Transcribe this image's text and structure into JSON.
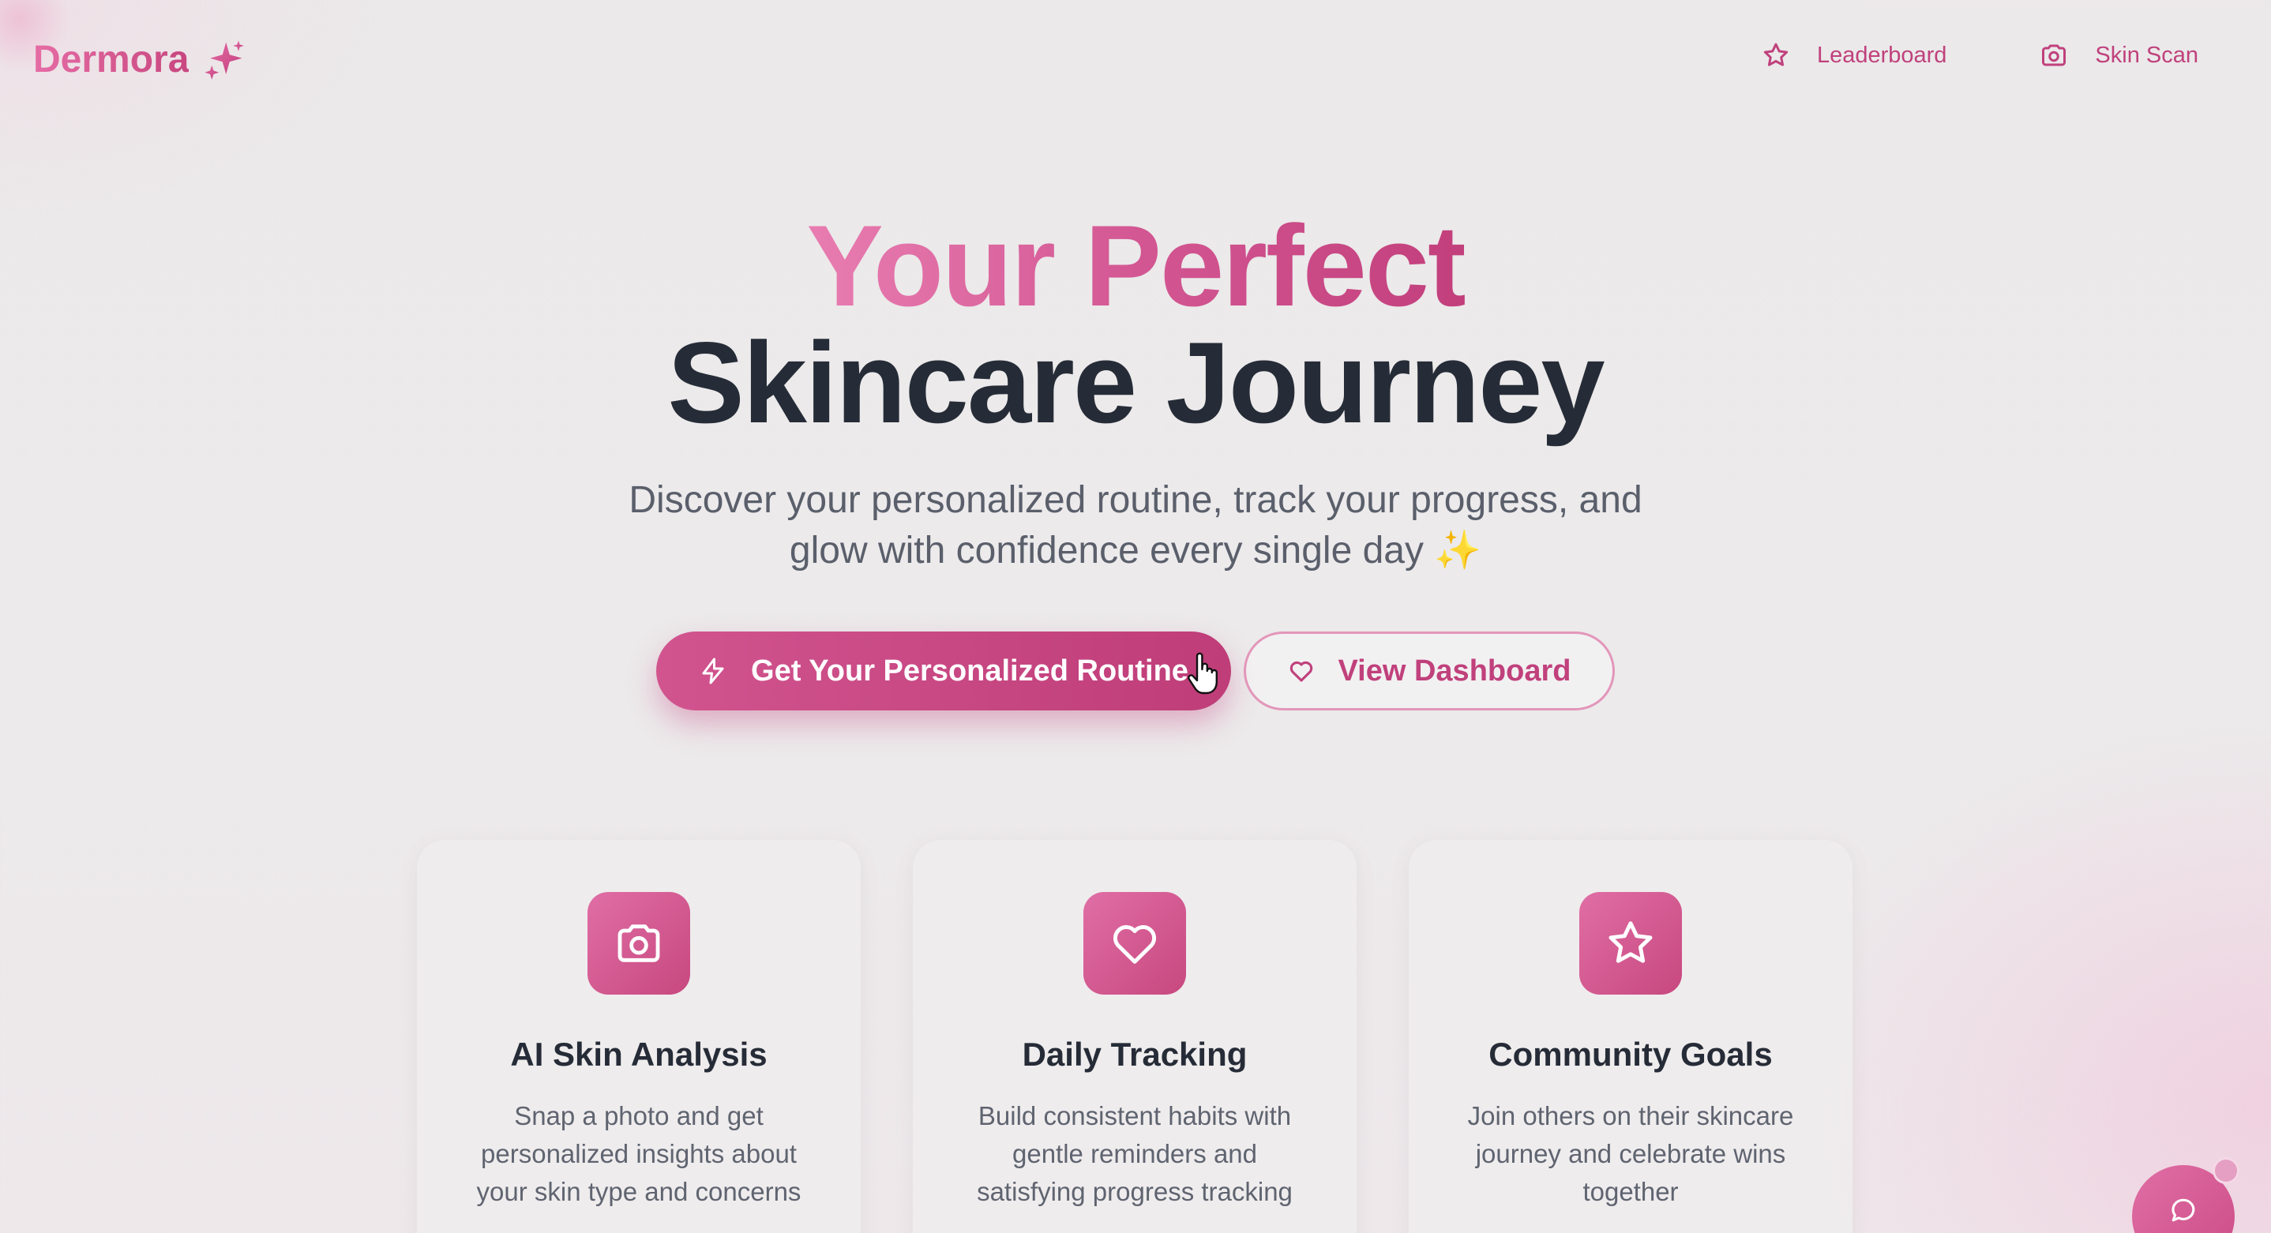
{
  "brand": {
    "name": "Dermora",
    "icon": "sparkles-icon"
  },
  "nav": {
    "leaderboard": {
      "label": "Leaderboard",
      "icon": "star-icon"
    },
    "skin_scan": {
      "label": "Skin Scan",
      "icon": "camera-icon"
    }
  },
  "hero": {
    "title_line1": "Your Perfect",
    "title_line2": "Skincare Journey",
    "subtitle_line1": "Discover your personalized routine, track your progress, and",
    "subtitle_line2": "glow with confidence every single day ✨"
  },
  "actions": {
    "primary": {
      "label": "Get Your Personalized Routine",
      "icon": "lightning-icon"
    },
    "secondary": {
      "label": "View Dashboard",
      "icon": "heart-icon"
    }
  },
  "features": [
    {
      "icon": "camera-icon",
      "title": "AI Skin Analysis",
      "text": "Snap a photo and get personalized insights about your skin type and concerns"
    },
    {
      "icon": "heart-icon",
      "title": "Daily Tracking",
      "text": "Build consistent habits with gentle reminders and satisfying progress tracking"
    },
    {
      "icon": "star-icon",
      "title": "Community Goals",
      "text": "Join others on their skincare journey and celebrate wins together"
    }
  ],
  "chat": {
    "icon": "chat-bubble-icon"
  },
  "colors": {
    "accent": "#c8477f",
    "accent_light": "#e56ca5",
    "heading": "#262c37",
    "body_text": "#5a5f6b",
    "background": "#ebe9ea"
  }
}
